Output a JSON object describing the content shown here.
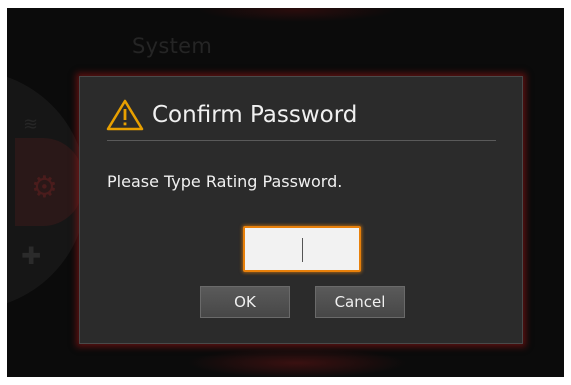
{
  "background": {
    "screen_title": "System",
    "icons": [
      "wifi-icon",
      "gear-icon",
      "tools-icon"
    ]
  },
  "dialog": {
    "title": "Confirm Password",
    "title_icon": "warning-icon",
    "message": "Please Type Rating Password.",
    "password_value": "",
    "ok_label": "OK",
    "cancel_label": "Cancel"
  },
  "colors": {
    "accent": "#e8800a",
    "dialog_bg": "#2b2b2b",
    "glow": "#961414"
  }
}
